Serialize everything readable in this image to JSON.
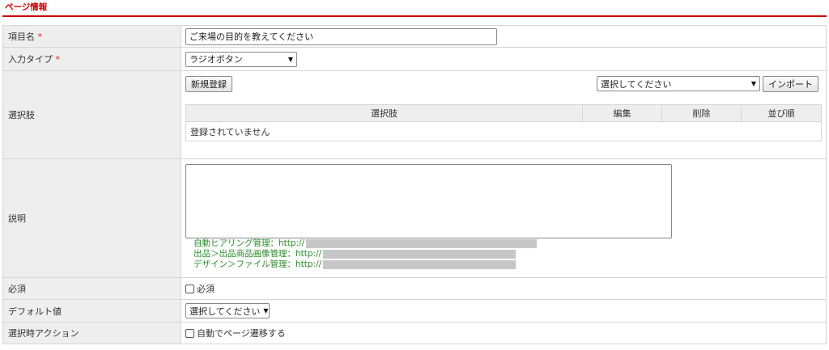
{
  "section": {
    "title": "ページ情報"
  },
  "fields": {
    "item_name": {
      "label": "項目名",
      "required_mark": "*",
      "value": "ご来場の目的を教えてください"
    },
    "input_type": {
      "label": "入力タイプ",
      "required_mark": "*",
      "selected": "ラジオボタン"
    },
    "choices": {
      "label": "選択肢",
      "new_button": "新規登録",
      "import_select": "選択してください",
      "import_button": "インポート",
      "columns": [
        "選択肢",
        "編集",
        "削除",
        "並び順"
      ],
      "empty_message": "登録されていません"
    },
    "description": {
      "label": "説明",
      "textarea_value": "",
      "links": [
        {
          "text": "自動ヒアリング管理：http://"
        },
        {
          "text": "出品＞出品商品画像管理：http://"
        },
        {
          "text": "デザイン＞ファイル管理：http://"
        }
      ]
    },
    "required": {
      "label": "必須",
      "checkbox_label": "必須",
      "checked": false
    },
    "default_value": {
      "label": "デフォルト値",
      "selected": "選択してください"
    },
    "select_action": {
      "label": "選択時アクション",
      "checkbox_label": "自動でページ遷移する",
      "checked": false
    }
  },
  "colors": {
    "accent": "#cc0000",
    "link": "#2c8a2c",
    "label_bg": "#eeeeee"
  }
}
